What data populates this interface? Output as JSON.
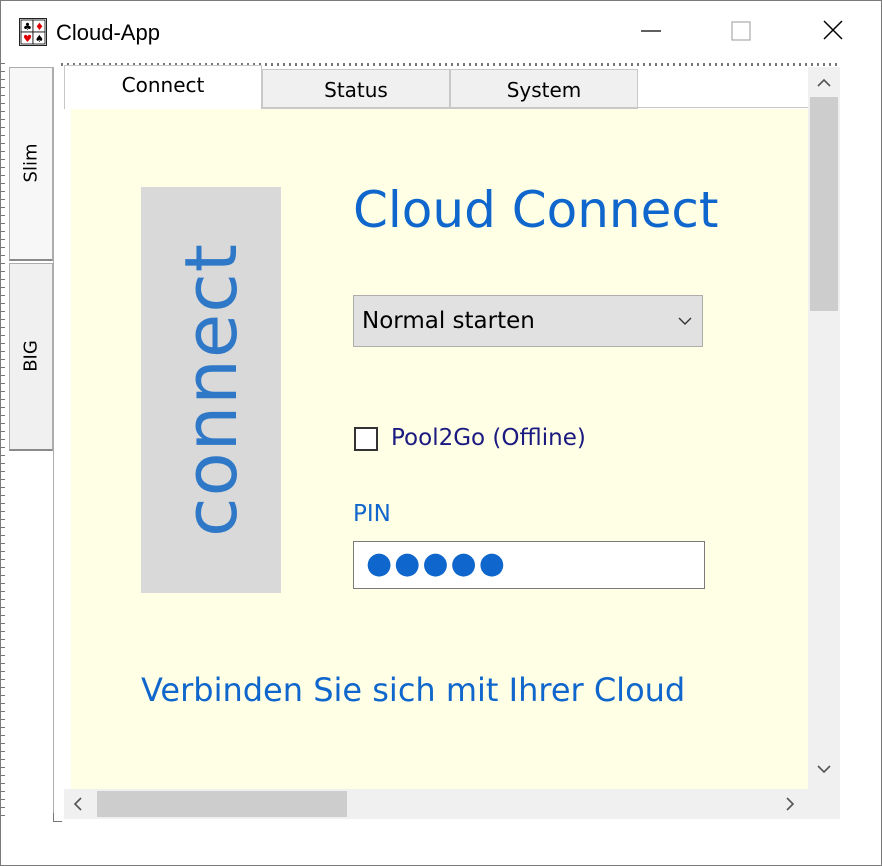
{
  "window": {
    "title": "Cloud-App",
    "icon": "playing-cards-icon",
    "controls": [
      "minimize-icon",
      "maximize-icon",
      "close-icon"
    ]
  },
  "side_tabs": [
    {
      "label": "Slim",
      "selected": true
    },
    {
      "label": "BIG",
      "selected": false
    }
  ],
  "tabs": [
    {
      "label": "Connect",
      "selected": true
    },
    {
      "label": "Status",
      "selected": false
    },
    {
      "label": "System",
      "selected": false
    }
  ],
  "connect_page": {
    "connect_button_label": "connect",
    "heading": "Cloud Connect",
    "start_mode": {
      "selected": "Normal starten"
    },
    "offline_checkbox": {
      "label": "Pool2Go (Offline)",
      "checked": false
    },
    "pin": {
      "label": "PIN",
      "masked_value": "●●●●●"
    },
    "tagline": "Verbinden Sie sich mit Ihrer Cloud"
  },
  "colors": {
    "page_background": "#ffffe5",
    "accent_blue": "#0f66cc",
    "connect_text": "#2e78c7",
    "checkbox_label": "#1a1a80",
    "connect_panel": "#d9d9d9"
  },
  "scrollbars": {
    "vertical": {
      "position_fraction": 0.0,
      "visible_fraction": 0.3
    },
    "horizontal": {
      "position_fraction": 0.0,
      "visible_fraction": 0.36
    }
  }
}
